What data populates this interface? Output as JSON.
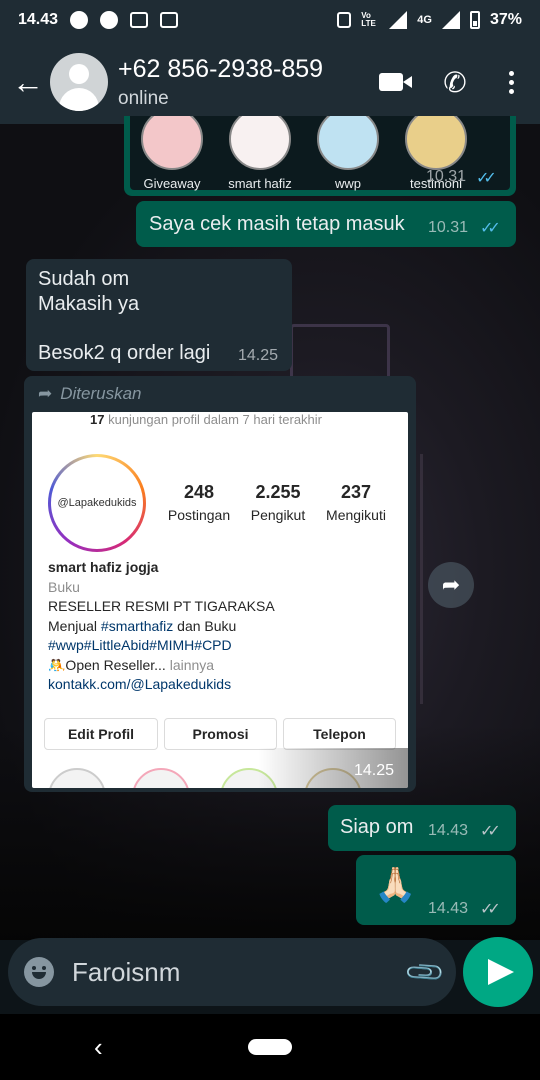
{
  "status_bar": {
    "time": "14.43",
    "volte": "Vo LTE",
    "network": "4G",
    "battery": "37%"
  },
  "header": {
    "contact_name": "+62 856-2938-859",
    "contact_status": "online"
  },
  "highlights_bubble": {
    "items": [
      "Giveaway",
      "smart hafiz",
      "wwp",
      "testimoni"
    ],
    "time": "10.31"
  },
  "messages": [
    {
      "id": "m1",
      "direction": "out",
      "text": "Saya cek masih tetap masuk",
      "time": "10.31",
      "tick": "read"
    },
    {
      "id": "m2",
      "direction": "in",
      "lines": [
        "Sudah om",
        "Makasih ya",
        "",
        "Besok2 q order lagi"
      ],
      "time": "14.25"
    },
    {
      "id": "m4",
      "direction": "out",
      "text": "Siap om",
      "time": "14.43",
      "tick": "delivered"
    },
    {
      "id": "m5",
      "direction": "out",
      "text": "🙏🏻",
      "time": "14.43",
      "tick": "delivered"
    }
  ],
  "forwarded": {
    "label": "Diteruskan",
    "time": "14.25",
    "profile": {
      "visits_count": "17",
      "visits_text": "kunjungan profil dalam 7 hari terakhir",
      "avatar_text": "@Lapakedukids",
      "stats": [
        {
          "value": "248",
          "label": "Postingan"
        },
        {
          "value": "2.255",
          "label": "Pengikut"
        },
        {
          "value": "237",
          "label": "Mengikuti"
        }
      ],
      "name": "smart hafiz jogja",
      "category": "Buku",
      "bio_line1": "RESELLER RESMI PT TIGARAKSA",
      "bio_line2_prefix": "Menjual ",
      "bio_line2_tag": "#smarthafiz",
      "bio_line2_suffix": " dan Buku",
      "hashtags": "#wwp#LittleAbid#MIMH#CPD",
      "bio_line4": "🤼Open Reseller...",
      "more": " lainnya",
      "link": "kontakk.com/@Lapakedukids",
      "buttons": [
        "Edit Profil",
        "Promosi",
        "Telepon"
      ]
    }
  },
  "input": {
    "value": "Faroisnm"
  },
  "colors": {
    "outgoing_bubble": "#005c4b",
    "incoming_bubble": "#1f2c34",
    "accent": "#00a884",
    "read_tick": "#53bdeb"
  },
  "icons": {
    "back": "arrow-left-icon",
    "video": "video-call-icon",
    "call": "phone-icon",
    "menu": "more-vertical-icon",
    "emoji": "emoji-icon",
    "attach": "paperclip-icon",
    "send": "send-icon",
    "forward": "forward-icon",
    "share": "share-icon"
  }
}
